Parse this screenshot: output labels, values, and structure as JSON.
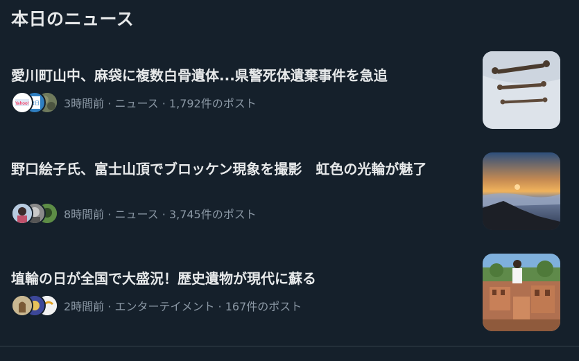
{
  "section": {
    "title": "本日のニュース"
  },
  "items": [
    {
      "headline": "愛川町山中、麻袋に複数白骨遺体...県警死体遺棄事件を急追",
      "time": "3時間前",
      "category": "ニュース",
      "posts": "1,792件のポスト",
      "avatar_labels": [
        "Yahoo!",
        "毎日"
      ]
    },
    {
      "headline": "野口絵子氏、富士山頂でブロッケン現象を撮影　虹色の光輪が魅了",
      "time": "8時間前",
      "category": "ニュース",
      "posts": "3,745件のポスト"
    },
    {
      "headline": "埴輪の日が全国で大盛況！歴史遺物が現代に蘇る",
      "time": "2時間前",
      "category": "エンターテイメント",
      "posts": "167件のポスト"
    }
  ],
  "separator": " · ",
  "colors": {
    "background": "#15202b",
    "text": "#e7e9ea",
    "secondary": "#8b98a5",
    "divider": "#38444d"
  }
}
